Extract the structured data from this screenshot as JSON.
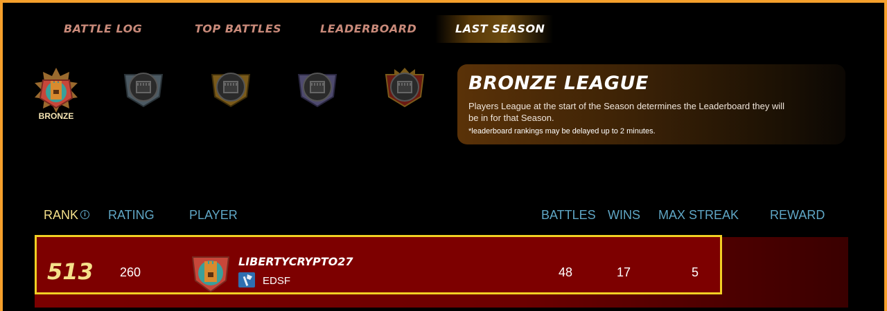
{
  "tabs": [
    {
      "label": "BATTLE LOG",
      "active": false
    },
    {
      "label": "TOP BATTLES",
      "active": false
    },
    {
      "label": "LEADERBOARD",
      "active": false
    },
    {
      "label": "LAST SEASON",
      "active": true
    }
  ],
  "leagues": {
    "selected_label": "BRONZE",
    "items": [
      {
        "icon": "bronze-league-icon",
        "active": true
      },
      {
        "icon": "silver-league-icon",
        "active": false
      },
      {
        "icon": "gold-league-icon",
        "active": false
      },
      {
        "icon": "diamond-league-icon",
        "active": false
      },
      {
        "icon": "champion-league-icon",
        "active": false
      }
    ]
  },
  "info": {
    "title": "BRONZE LEAGUE",
    "description": "Players League at the start of the Season determines the Leaderboard they will be in for that Season.",
    "note": "*leaderboard rankings may be delayed up to 2 minutes."
  },
  "table": {
    "headers": {
      "rank": "RANK",
      "rating": "RATING",
      "player": "PLAYER",
      "battles": "BATTLES",
      "wins": "WINS",
      "max_streak": "MAX STREAK",
      "reward": "REWARD"
    },
    "rows": [
      {
        "rank": "513",
        "rating": "260",
        "player": "LIBERTYCRYPTO27",
        "guild": "EDSF",
        "battles": "48",
        "wins": "17",
        "max_streak": "5",
        "reward": ""
      }
    ]
  },
  "colors": {
    "frame": "#f5a02c",
    "header": "#5fa6c5",
    "rank_header": "#f5e08a",
    "row_highlight": "#f2d024",
    "row_bg": "#7a0000"
  }
}
